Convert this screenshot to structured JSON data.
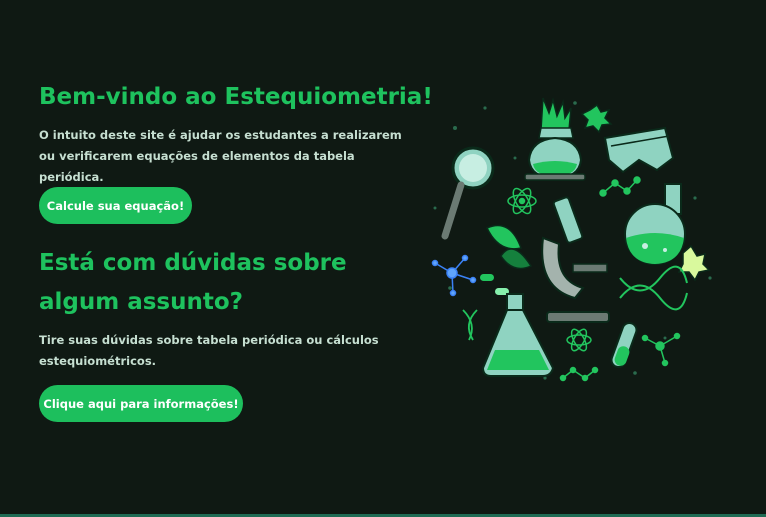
{
  "hero": {
    "title": "Bem-vindo ao Estequiometria!",
    "description": "O intuito deste site é ajudar os estudantes a realizarem ou verificarem equações de elementos da tabela periódica.",
    "button_label": "Calcule sua equação!"
  },
  "help": {
    "title": "Está com dúvidas sobre algum assunto?",
    "description": "Tire suas dúvidas sobre tabela periódica ou cálculos estequiométricos.",
    "button_label": "Clique aqui para informações!"
  },
  "illustration": {
    "icon": "chemistry-lab-illustration",
    "colors": {
      "green": "#22c55e",
      "dark": "#0f1913",
      "glass": "#8fd3c1",
      "outline": "#0a2a1a"
    }
  },
  "colors": {
    "background": "#0f1913",
    "accent": "#1ec25e",
    "button": "#1dbf5d",
    "text": "#c6dfd1"
  }
}
